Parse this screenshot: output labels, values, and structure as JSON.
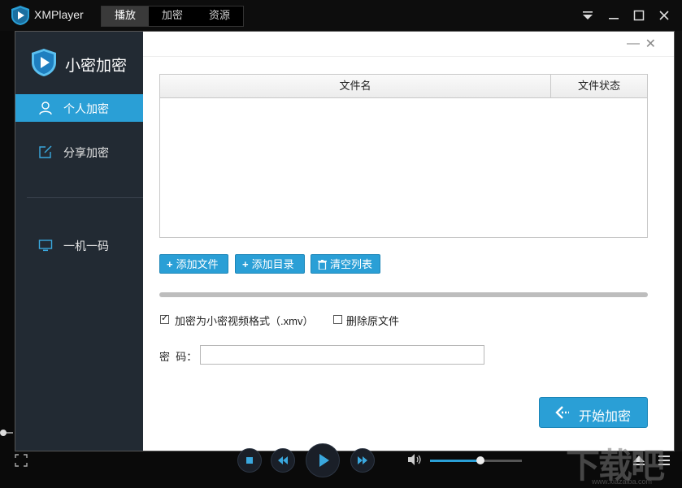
{
  "app": {
    "title": "XMPlayer",
    "tabs": [
      {
        "label": "播放",
        "active": true
      },
      {
        "label": "加密",
        "active": false
      },
      {
        "label": "资源",
        "active": false
      }
    ]
  },
  "dialog": {
    "sidebar": {
      "title": "小密加密",
      "items": [
        {
          "label": "个人加密",
          "icon": "user-icon",
          "active": true
        },
        {
          "label": "分享加密",
          "icon": "share-edit-icon",
          "active": false
        },
        {
          "label": "一机一码",
          "icon": "monitor-icon",
          "active": false
        }
      ]
    },
    "table": {
      "columns": [
        "文件名",
        "文件状态"
      ],
      "rows": []
    },
    "buttons": {
      "add_file": "添加文件",
      "add_dir": "添加目录",
      "clear_list": "清空列表"
    },
    "progress": 0,
    "options": {
      "xmv_format": {
        "label": "加密为小密视频格式（.xmv）",
        "checked": true
      },
      "delete_original": {
        "label": "删除原文件",
        "checked": false
      }
    },
    "password": {
      "label": "密  码：",
      "value": ""
    },
    "start_button": "开始加密"
  },
  "player": {
    "volume": 0.55
  },
  "watermark": {
    "text": "下载吧",
    "url": "www.xiazaiba.com"
  },
  "colors": {
    "accent": "#2a9fd6",
    "sidebar_bg": "#222a33",
    "titlebar_bg": "#0d0d0d"
  }
}
